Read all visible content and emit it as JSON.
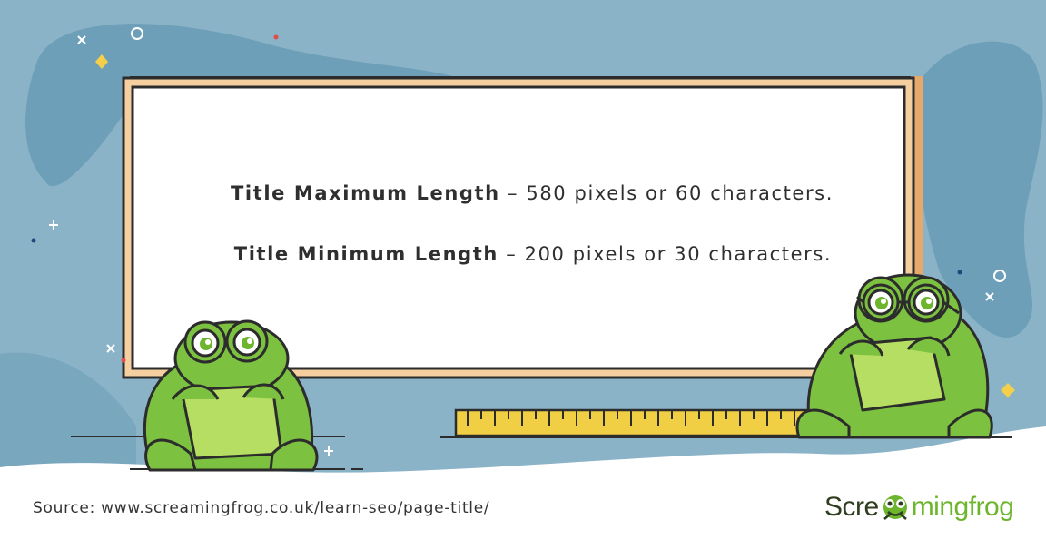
{
  "board": {
    "max_label": "Title Maximum Length",
    "max_value": " – 580 pixels or 60 characters.",
    "min_label": "Title Minimum Length",
    "min_value": " – 200 pixels or 30 characters."
  },
  "footer": {
    "source": "Source: www.screamingfrog.co.uk/learn-seo/page-title/",
    "logo_lettering": "Screamingfrog"
  },
  "logo": {
    "left_text": "Scre",
    "right_text": "mingfrog"
  },
  "colors": {
    "sky": "#8bb3c8",
    "blob": "#6e9fb8",
    "board_frame": "#f5cf9f",
    "board_face": "#ffffff",
    "ruler": "#f1cf45",
    "frog_green": "#7cc240",
    "frog_light": "#b6de63",
    "logo_green": "#6cb52d"
  },
  "icons": [
    "sparkle-icon",
    "diamond-icon",
    "ring-icon",
    "cross-icon",
    "dot-icon"
  ]
}
